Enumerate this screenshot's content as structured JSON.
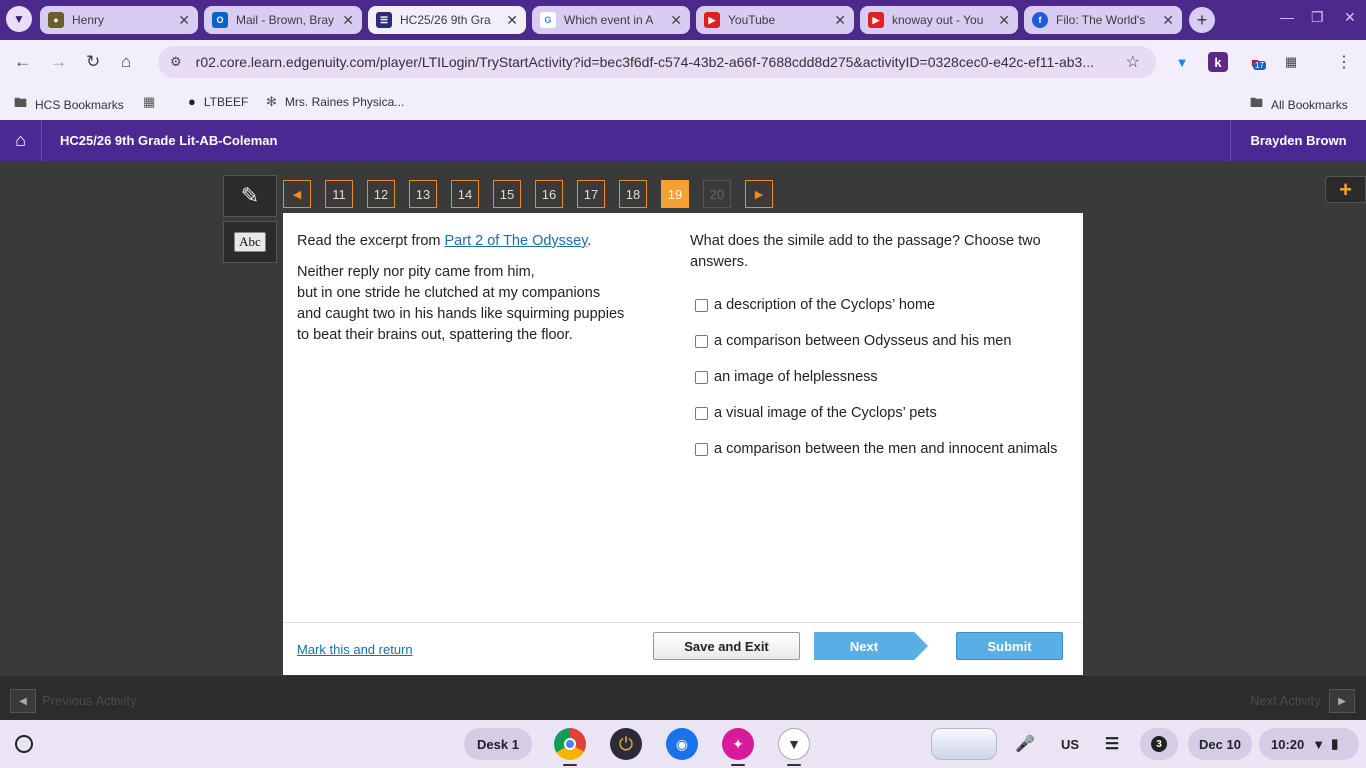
{
  "browser": {
    "tabs": [
      {
        "title": "Henry",
        "favicon_color": "#6b5e2a"
      },
      {
        "title": "Mail - Brown, Bray",
        "favicon_color": "#0a64c8"
      },
      {
        "title": "HC25/26 9th Gra",
        "favicon_color": "#2b2d7a"
      },
      {
        "title": "Which event in A",
        "favicon_color": "#4285f4"
      },
      {
        "title": "YouTube",
        "favicon_color": "#e02020"
      },
      {
        "title": "knoway out - You",
        "favicon_color": "#e02020"
      },
      {
        "title": "Filo: The World's",
        "favicon_color": "#1e5bd8"
      }
    ],
    "url": "r02.core.learn.edgenuity.com/player/LTILogin/TryStartActivity?id=bec3f6df-c574-43b2-a66f-7688cdd8d275&activityID=0328cec0-e42c-ef11-ab3...",
    "extension_badge": "17",
    "bookmarks": [
      {
        "label": "HCS Bookmarks"
      },
      {
        "label": "LTBEEF"
      },
      {
        "label": "Mrs. Raines Physica..."
      }
    ],
    "all_bookmarks": "All Bookmarks"
  },
  "app": {
    "course_title": "HC25/26 9th Grade Lit-AB-Coleman",
    "user_name": "Brayden Brown"
  },
  "question_nav": {
    "items": [
      "11",
      "12",
      "13",
      "14",
      "15",
      "16",
      "17",
      "18",
      "19",
      "20"
    ],
    "current": "19"
  },
  "content": {
    "intro_prefix": "Read the excerpt from ",
    "intro_link": "Part 2 of The Odyssey",
    "intro_suffix": ".",
    "excerpt_lines": [
      "Neither reply nor pity came from him,",
      "but in one stride he clutched at my companions",
      "and caught two in his hands like squirming puppies",
      "to beat their brains out, spattering the floor."
    ],
    "question": "What does the simile add to the passage? Choose two answers.",
    "options": [
      "a description of the Cyclops’ home",
      "a comparison between Odysseus and his men",
      "an image of helplessness",
      "a visual image of the Cyclops’ pets",
      "a comparison between the men and innocent animals"
    ]
  },
  "footer": {
    "mark_return": "Mark this and return",
    "save_exit": "Save and Exit",
    "next": "Next",
    "submit": "Submit"
  },
  "activity_nav": {
    "prev": "Previous Activity",
    "next": "Next Activity"
  },
  "shelf": {
    "desk": "Desk 1",
    "keyboard": "US",
    "notifications": "3",
    "date": "Dec 10",
    "time": "10:20"
  }
}
